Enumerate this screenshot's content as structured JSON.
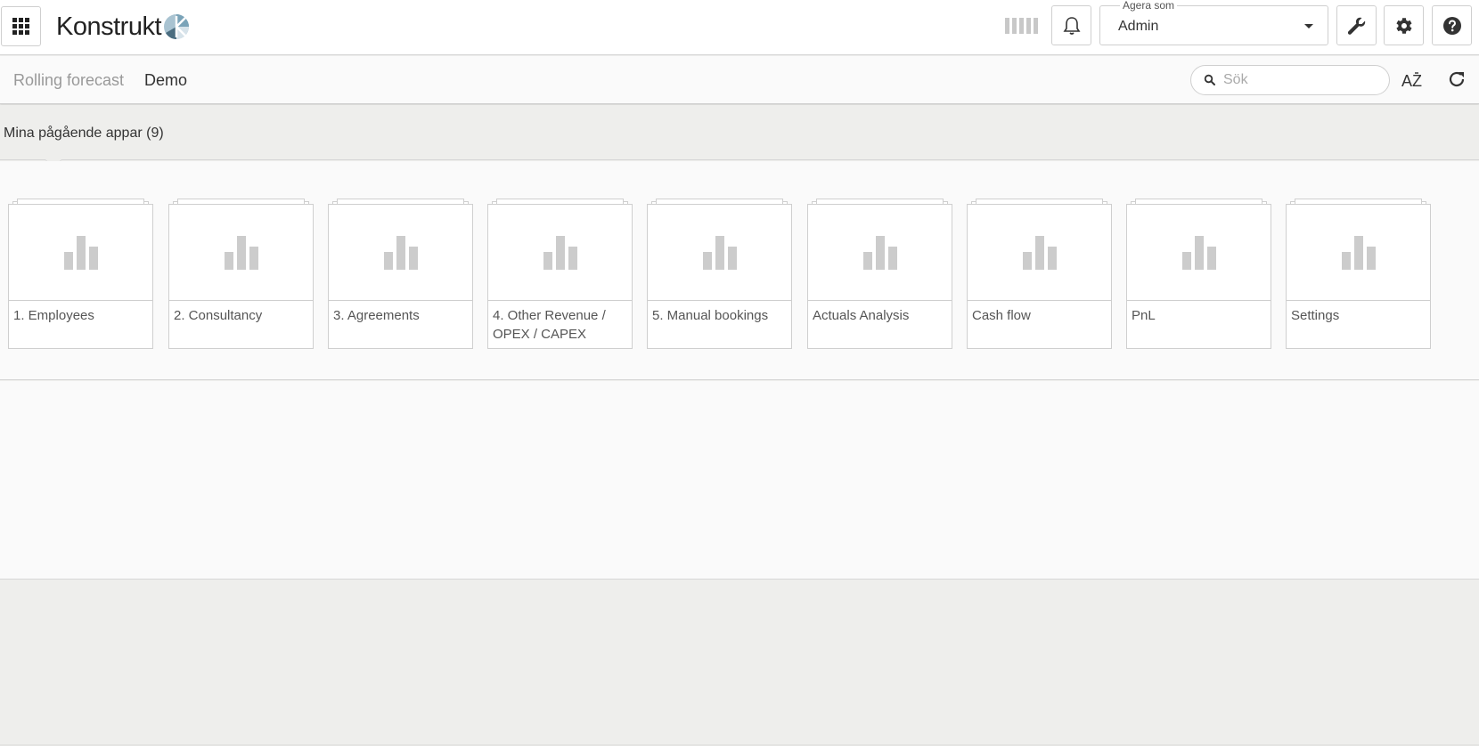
{
  "header": {
    "brand": "Konstrukt",
    "acting_as_label": "Agera som",
    "acting_as_value": "Admin"
  },
  "subbar": {
    "breadcrumb": [
      "Rolling forecast",
      "Demo"
    ],
    "search_placeholder": "Sök",
    "sort_label": "AZ"
  },
  "section": {
    "title": "Mina pågående appar (9)"
  },
  "apps": [
    {
      "label": "1. Employees"
    },
    {
      "label": "2. Consultancy"
    },
    {
      "label": "3. Agreements"
    },
    {
      "label": "4. Other Revenue / OPEX / CAPEX"
    },
    {
      "label": "5. Manual bookings"
    },
    {
      "label": "Actuals Analysis"
    },
    {
      "label": "Cash flow"
    },
    {
      "label": "PnL"
    },
    {
      "label": "Settings"
    }
  ],
  "colors": {
    "brand_logo_blue": "#7aa3b8",
    "brand_logo_dark": "#4a6d80",
    "thumb_icon": "#cccccc"
  }
}
